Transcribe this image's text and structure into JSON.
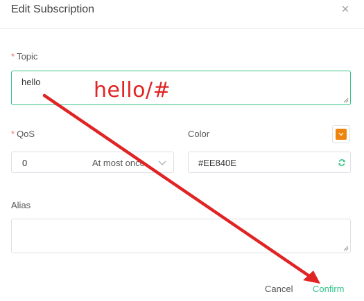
{
  "dialog": {
    "title": "Edit Subscription",
    "close_symbol": "×"
  },
  "topic": {
    "required_mark": "*",
    "label": "Topic",
    "value": "hello"
  },
  "qos": {
    "required_mark": "*",
    "label": "QoS",
    "value": "0",
    "description": "At most once"
  },
  "color": {
    "label": "Color",
    "value": "#EE840E",
    "swatch_color": "#EE840E"
  },
  "alias": {
    "label": "Alias",
    "value": ""
  },
  "footer": {
    "cancel_label": "Cancel",
    "confirm_label": "Confirm"
  },
  "annotation": {
    "text": "hello/#",
    "color": "#e02424"
  },
  "accent_color": "#34c388"
}
